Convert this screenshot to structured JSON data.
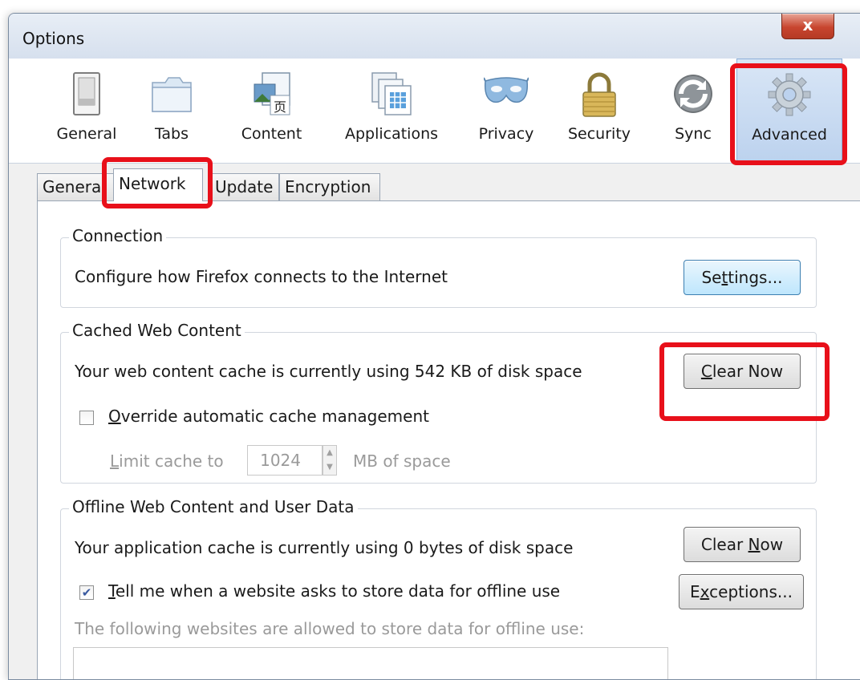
{
  "window": {
    "title": "Options",
    "close_glyph": "x"
  },
  "panes": [
    {
      "label": "General",
      "icon": "switch-icon"
    },
    {
      "label": "Tabs",
      "icon": "folder-tabs-icon"
    },
    {
      "label": "Content",
      "icon": "content-page-icon"
    },
    {
      "label": "Applications",
      "icon": "applications-icon"
    },
    {
      "label": "Privacy",
      "icon": "mask-icon"
    },
    {
      "label": "Security",
      "icon": "padlock-icon"
    },
    {
      "label": "Sync",
      "icon": "sync-icon"
    },
    {
      "label": "Advanced",
      "icon": "gear-icon",
      "selected": true
    }
  ],
  "subtabs": [
    {
      "label": "Genera"
    },
    {
      "label": "Network",
      "selected": true
    },
    {
      "label": "Update"
    },
    {
      "label": "Encryption"
    }
  ],
  "connection": {
    "legend": "Connection",
    "description": "Configure how Firefox connects to the Internet",
    "settings_button": {
      "pre": "Se",
      "key": "t",
      "post": "tings..."
    }
  },
  "cache": {
    "legend": "Cached Web Content",
    "usage_text": "Your web content cache is currently using 542 KB of disk space",
    "clear_button": {
      "pre": "",
      "key": "C",
      "post": "lear Now"
    },
    "override_label": {
      "pre": "",
      "key": "O",
      "post": "verride automatic cache management"
    },
    "override_checked": false,
    "limit_label": {
      "pre": "",
      "key": "L",
      "post": "imit cache to"
    },
    "limit_value": "1024",
    "limit_unit": "MB of space"
  },
  "offline": {
    "legend": "Offline Web Content and User Data",
    "usage_text": "Your application cache is currently using 0 bytes of disk space",
    "clear_button": {
      "pre": "Clear ",
      "key": "N",
      "post": "ow"
    },
    "tell_label": {
      "pre": "",
      "key": "T",
      "post": "ell me when a website asks to store data for offline use"
    },
    "tell_checked": true,
    "exceptions_button": {
      "pre": "E",
      "key": "x",
      "post": "ceptions..."
    },
    "allowed_caption": "The following websites are allowed to store data for offline use:"
  },
  "colors": {
    "highlight": "#e8101a",
    "selected_pane": "#bcd2ee"
  }
}
